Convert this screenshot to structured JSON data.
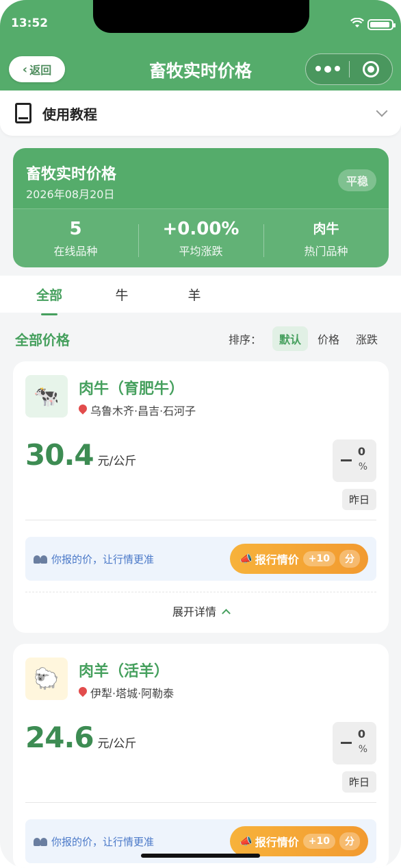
{
  "status_bar": {
    "time": "13:52"
  },
  "nav": {
    "back_label": "返回",
    "title": "畜牧实时价格"
  },
  "tutorial": {
    "label": "使用教程"
  },
  "summary": {
    "title": "畜牧实时价格",
    "date": "2026年08月20日",
    "badge": "平稳",
    "stats": [
      {
        "value": "5",
        "label": "在线品种"
      },
      {
        "value": "+0.00%",
        "label": "平均涨跌"
      },
      {
        "value": "肉牛",
        "label": "热门品种"
      }
    ]
  },
  "tabs": [
    "全部",
    "牛",
    "羊"
  ],
  "active_tab": "全部",
  "list_header": {
    "title": "全部价格",
    "sort_label": "排序：",
    "sort_options": [
      "默认",
      "价格",
      "涨跌"
    ],
    "active_sort": "默认"
  },
  "cards": [
    {
      "name": "肉牛（育肥牛）",
      "location": "乌鲁木齐·昌吉·石河子",
      "price": "30.4",
      "unit": "元/公斤",
      "change": "0",
      "change_unit": "%",
      "compare": "昨日",
      "report_text": "你报的价，让行情更准",
      "report_button": "报行情价",
      "points": "+10",
      "points_unit": "分",
      "expand": "展开详情",
      "icon": "cow-icon"
    },
    {
      "name": "肉羊（活羊）",
      "location": "伊犁·塔城·阿勒泰",
      "price": "24.6",
      "unit": "元/公斤",
      "change": "0",
      "change_unit": "%",
      "compare": "昨日",
      "report_text": "你报的价，让行情更准",
      "report_button": "报行情价",
      "points": "+10",
      "points_unit": "分",
      "icon": "sheep-icon"
    }
  ],
  "colors": {
    "brand_green": "#55ac6b",
    "accent_green": "#46a05e",
    "orange": "#f29a30"
  }
}
